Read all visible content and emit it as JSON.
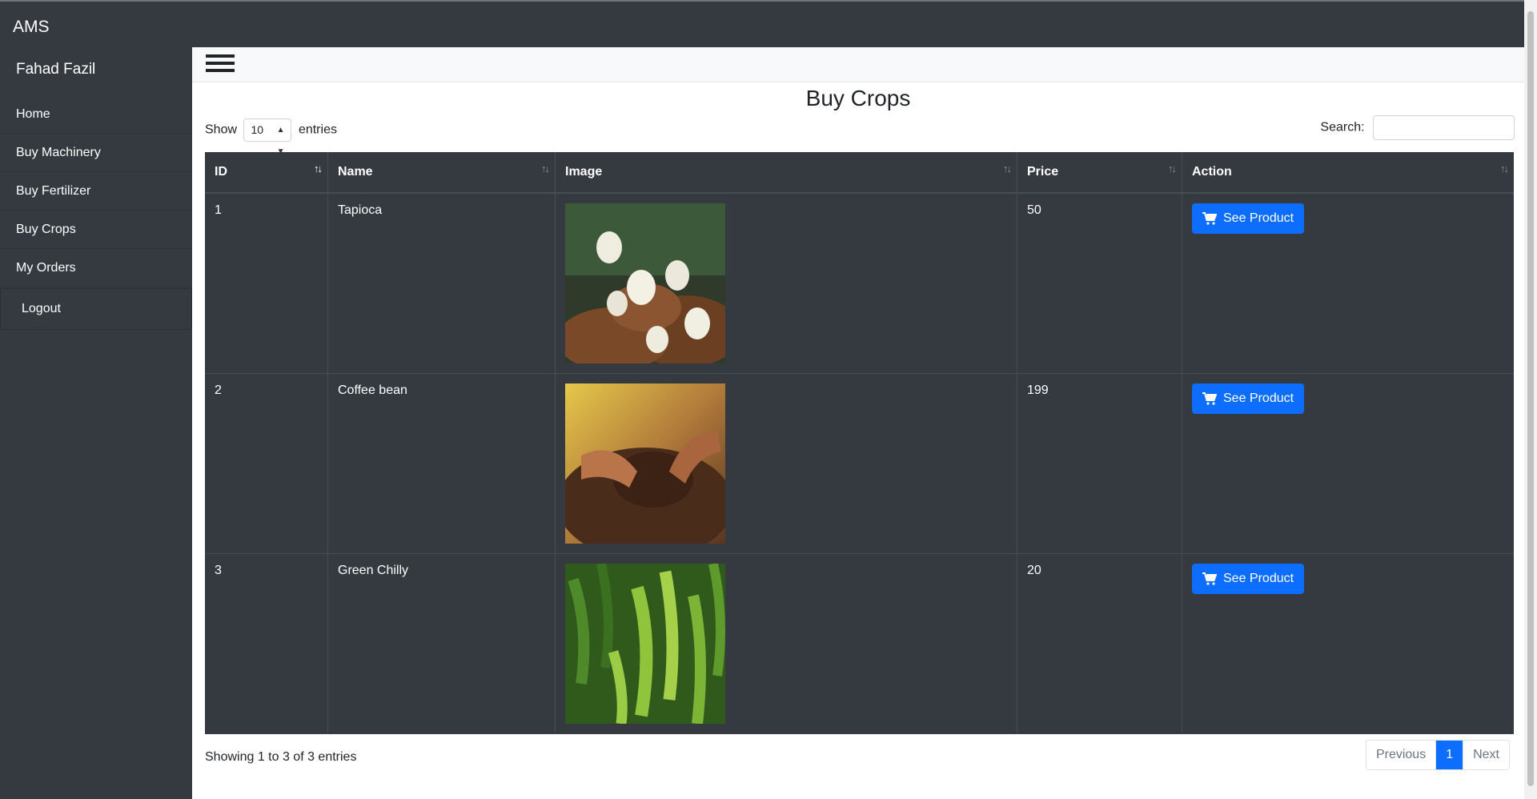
{
  "app": {
    "brand": "AMS"
  },
  "sidebar": {
    "user_name": "Fahad Fazil",
    "items": [
      {
        "label": "Home"
      },
      {
        "label": "Buy Machinery"
      },
      {
        "label": "Buy Fertilizer"
      },
      {
        "label": "Buy Crops"
      },
      {
        "label": "My Orders"
      }
    ],
    "logout": "Logout"
  },
  "main": {
    "title": "Buy Crops",
    "length": {
      "prefix": "Show",
      "value": "10",
      "suffix": "entries"
    },
    "search": {
      "label": "Search:",
      "value": ""
    },
    "table": {
      "headers": [
        "ID",
        "Name",
        "Image",
        "Price",
        "Action"
      ],
      "rows": [
        {
          "id": "1",
          "name": "Tapioca",
          "image": "tapioca-photo",
          "price": "50",
          "action": "See Product"
        },
        {
          "id": "2",
          "name": "Coffee bean",
          "image": "coffee-bean-photo",
          "price": "199",
          "action": "See Product"
        },
        {
          "id": "3",
          "name": "Green Chilly",
          "image": "green-chilly-photo",
          "price": "20",
          "action": "See Product"
        }
      ]
    },
    "info": "Showing 1 to 3 of 3 entries",
    "pagination": {
      "previous": "Previous",
      "current": "1",
      "next": "Next"
    }
  },
  "colors": {
    "dark": "#343a40",
    "primary": "#0d6efd",
    "light": "#f8f9fa"
  },
  "icons": {
    "menu": "hamburger-icon",
    "cart": "cart-icon",
    "sort": "sort-icon"
  }
}
